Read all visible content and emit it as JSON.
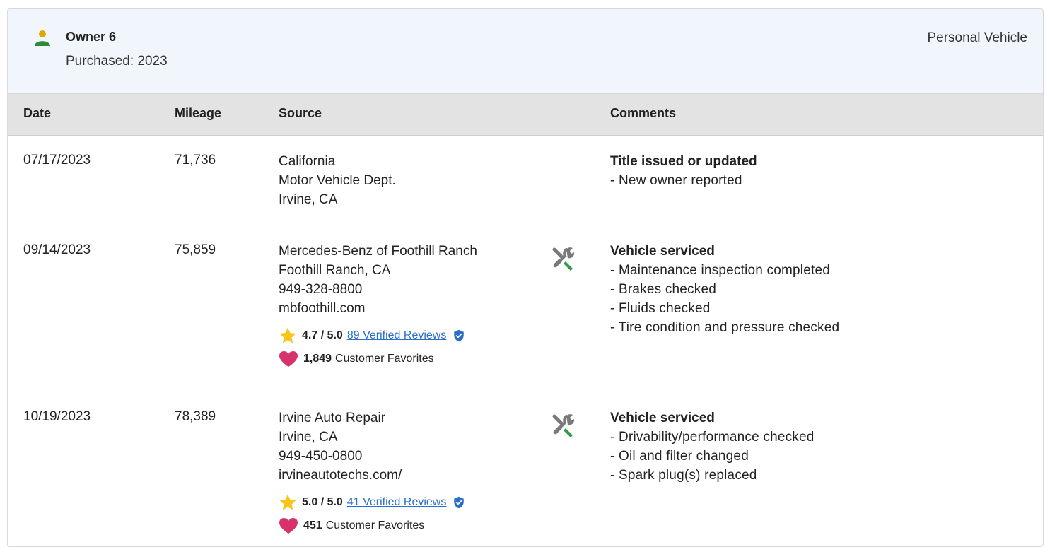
{
  "owner": {
    "name": "Owner 6",
    "purchased": "Purchased: 2023",
    "type": "Personal Vehicle"
  },
  "columns": {
    "date": "Date",
    "mileage": "Mileage",
    "source": "Source",
    "comments": "Comments"
  },
  "records": [
    {
      "date": "07/17/2023",
      "mileage": "71,736",
      "source": [
        "California",
        "Motor Vehicle Dept.",
        "Irvine, CA"
      ],
      "comment_title": "Title issued or updated",
      "comment_items": [
        "- New owner reported"
      ]
    },
    {
      "date": "09/14/2023",
      "mileage": "75,859",
      "source": [
        "Mercedes-Benz of Foothill Ranch",
        "Foothill Ranch, CA",
        "949-328-8800",
        "mbfoothill.com"
      ],
      "rating_score": "4.7 / 5.0",
      "reviews_link": "89 Verified Reviews",
      "favorites_count": "1,849",
      "favorites_label": "Customer Favorites",
      "service_icon": "wrench-screwdriver-icon",
      "comment_title": "Vehicle serviced",
      "comment_items": [
        "- Maintenance inspection completed",
        "- Brakes checked",
        "- Fluids checked",
        "- Tire condition and pressure checked"
      ]
    },
    {
      "date": "10/19/2023",
      "mileage": "78,389",
      "source": [
        "Irvine Auto Repair",
        "Irvine, CA",
        "949-450-0800",
        "irvineautotechs.com/"
      ],
      "rating_score": "5.0 / 5.0",
      "reviews_link": "41 Verified Reviews",
      "favorites_count": "451",
      "favorites_label": "Customer Favorites",
      "service_icon": "wrench-screwdriver-icon",
      "comment_title": "Vehicle serviced",
      "comment_items": [
        "- Drivability/performance checked",
        "- Oil and filter changed",
        "- Spark plug(s) replaced"
      ]
    }
  ],
  "colors": {
    "header_bg": "#f0f6fb",
    "table_header_bg": "#e3e3e3",
    "link": "#2a6fc9",
    "star": "#f5c518",
    "heart": "#d6336c",
    "verified": "#2a6fc9",
    "owner_icon_head": "#e0a800",
    "owner_icon_body": "#2e8b3a",
    "service_icon": "#2e9e45"
  }
}
